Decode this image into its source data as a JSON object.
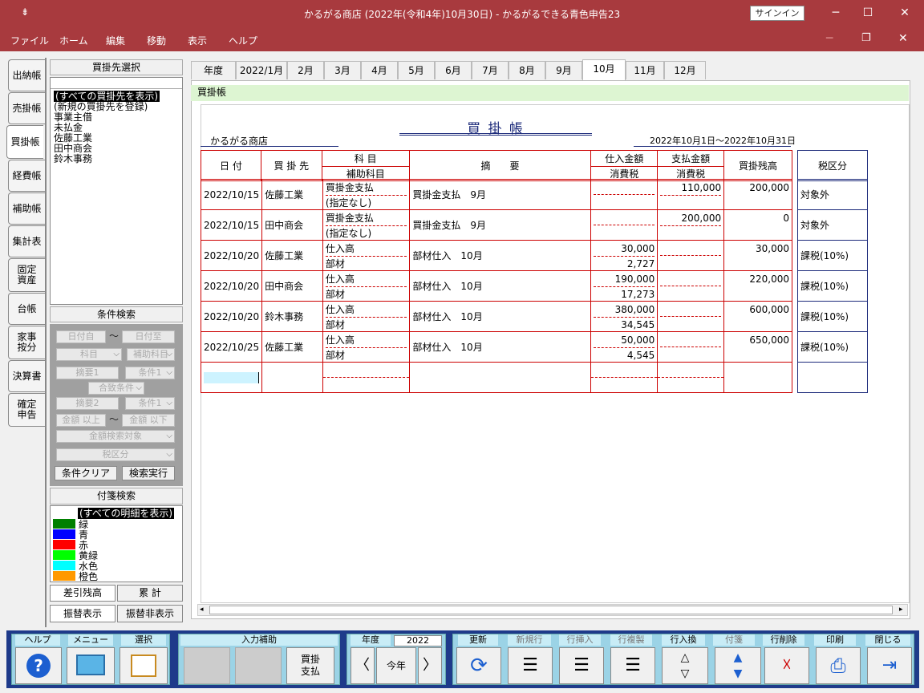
{
  "window": {
    "title": "かるがる商店 (2022年(令和4年)10月30日)  -  かるがるできる青色申告23",
    "signin": "サインイン"
  },
  "menu": [
    "ファイル",
    "ホーム",
    "編集",
    "移動",
    "表示",
    "ヘルプ"
  ],
  "nav": [
    "出納帳",
    "売掛帳",
    "買掛帳",
    "経費帳",
    "補助帳",
    "集計表",
    "固定\n資産",
    "台帳",
    "家事\n按分",
    "決算書",
    "確定\n申告"
  ],
  "supplier_panel": {
    "header": "買掛先選択",
    "items": [
      "(すべての買掛先を表示)",
      "(新規の買掛先を登録)",
      "事業主借",
      "未払金",
      "佐藤工業",
      "田中商会",
      "鈴木事務"
    ]
  },
  "search_panel": {
    "header": "条件検索",
    "date_from": "日付自",
    "tilde": "〜",
    "date_to": "日付至",
    "account": "科目",
    "sub_account": "補助科目",
    "memo1": "摘要1",
    "cond1": "条件1",
    "match": "合致条件",
    "memo2": "摘要2",
    "cond2": "条件1",
    "amt_min": "金額 以上",
    "amt_max": "金額 以下",
    "amt_target": "金額検索対象",
    "tax": "税区分",
    "clear": "条件クリア",
    "run": "検索実行"
  },
  "tag_panel": {
    "header": "付箋検索",
    "all": "(すべての明細を表示)",
    "tags": [
      {
        "label": "緑",
        "color": "#008000"
      },
      {
        "label": "青",
        "color": "#0000ff"
      },
      {
        "label": "赤",
        "color": "#ff0000"
      },
      {
        "label": "黄緑",
        "color": "#00ff00"
      },
      {
        "label": "水色",
        "color": "#00ffff"
      },
      {
        "label": "橙色",
        "color": "#ff9900"
      }
    ]
  },
  "bottom_tabs": [
    "差引残高",
    "累 計",
    "振替表示",
    "振替非表示"
  ],
  "month_tabs": [
    "年度",
    "2022/1月",
    "2月",
    "3月",
    "4月",
    "5月",
    "6月",
    "7月",
    "8月",
    "9月",
    "10月",
    "11月",
    "12月"
  ],
  "ledger": {
    "breadcrumb": "買掛帳",
    "title": "買 掛 帳",
    "company": "かるがる商店",
    "period": "2022年10月1日〜2022年10月31日",
    "headers": {
      "date": "日 付",
      "vendor": "買 掛 先",
      "account": "科 目",
      "sub_account": "補助科目",
      "memo": "摘　　要",
      "purchase": "仕入金額",
      "tax1": "消費税",
      "payment": "支払金額",
      "tax2": "消費税",
      "balance": "買掛残高",
      "taxclass": "税区分"
    },
    "rows": [
      {
        "date": "2022/10/15",
        "vendor": "佐藤工業",
        "account": "買掛金支払",
        "sub": "(指定なし)",
        "memo": "買掛金支払　9月",
        "purchase": "",
        "ptax": "",
        "payment": "110,000",
        "payt": "",
        "balance": "200,000",
        "tax": "対象外"
      },
      {
        "date": "2022/10/15",
        "vendor": "田中商会",
        "account": "買掛金支払",
        "sub": "(指定なし)",
        "memo": "買掛金支払　9月",
        "purchase": "",
        "ptax": "",
        "payment": "200,000",
        "payt": "",
        "balance": "0",
        "tax": "対象外"
      },
      {
        "date": "2022/10/20",
        "vendor": "佐藤工業",
        "account": "仕入高",
        "sub": "部材",
        "memo": "部材仕入　10月",
        "purchase": "30,000",
        "ptax": "2,727",
        "payment": "",
        "payt": "",
        "balance": "30,000",
        "tax": "課税(10%)"
      },
      {
        "date": "2022/10/20",
        "vendor": "田中商会",
        "account": "仕入高",
        "sub": "部材",
        "memo": "部材仕入　10月",
        "purchase": "190,000",
        "ptax": "17,273",
        "payment": "",
        "payt": "",
        "balance": "220,000",
        "tax": "課税(10%)"
      },
      {
        "date": "2022/10/20",
        "vendor": "鈴木事務",
        "account": "仕入高",
        "sub": "部材",
        "memo": "部材仕入　10月",
        "purchase": "380,000",
        "ptax": "34,545",
        "payment": "",
        "payt": "",
        "balance": "600,000",
        "tax": "課税(10%)"
      },
      {
        "date": "2022/10/25",
        "vendor": "佐藤工業",
        "account": "仕入高",
        "sub": "部材",
        "memo": "部材仕入　10月",
        "purchase": "50,000",
        "ptax": "4,545",
        "payment": "",
        "payt": "",
        "balance": "650,000",
        "tax": "課税(10%)"
      }
    ]
  },
  "toolbar": {
    "help": "ヘルプ",
    "menu": "メニュー",
    "select": "選択",
    "input_assist": "入力補助",
    "kaikake_pay": "買掛\n支払",
    "year_label": "年度",
    "year": "2022",
    "this_year": "今年",
    "update": "更新",
    "new_row": "新規行",
    "insert_row": "行挿入",
    "copy_row": "行複製",
    "swap_row": "行入換",
    "tag": "付箋",
    "delete_row": "行削除",
    "print": "印刷",
    "close": "閉じる"
  }
}
